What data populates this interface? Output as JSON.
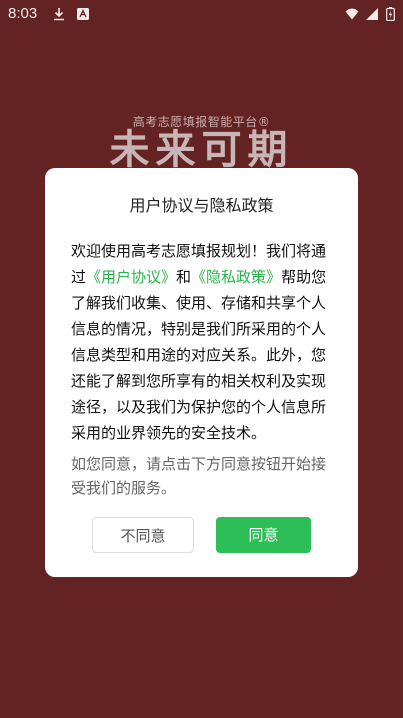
{
  "status_bar": {
    "time": "8:03",
    "left_icons": [
      "download-icon",
      "app-notification-icon"
    ],
    "right_icons": [
      "wifi-icon",
      "signal-icon",
      "battery-icon"
    ]
  },
  "background": {
    "subtitle": "高考志愿填报智能平台®",
    "title": "未来可期"
  },
  "dialog": {
    "title": "用户协议与隐私政策",
    "body_before_link1": "欢迎使用高考志愿填报规划！我们将通过",
    "link_user_agreement": "《用户协议》",
    "body_between_links": "和",
    "link_privacy_policy": "《隐私政策》",
    "body_after_links": "帮助您了解我们收集、使用、存储和共享个人信息的情况，特别是我们所采用的个人信息类型和用途的对应关系。此外，您还能了解到您所享有的相关权利及实现途径，以及我们为保护您的个人信息所采用的业界领先的安全技术。",
    "note": "如您同意，请点击下方同意按钮开始接受我们的服务。",
    "disagree_label": "不同意",
    "agree_label": "同意"
  },
  "colors": {
    "background": "#622322",
    "link": "#29b34c",
    "agree_button": "#2ebe57"
  }
}
